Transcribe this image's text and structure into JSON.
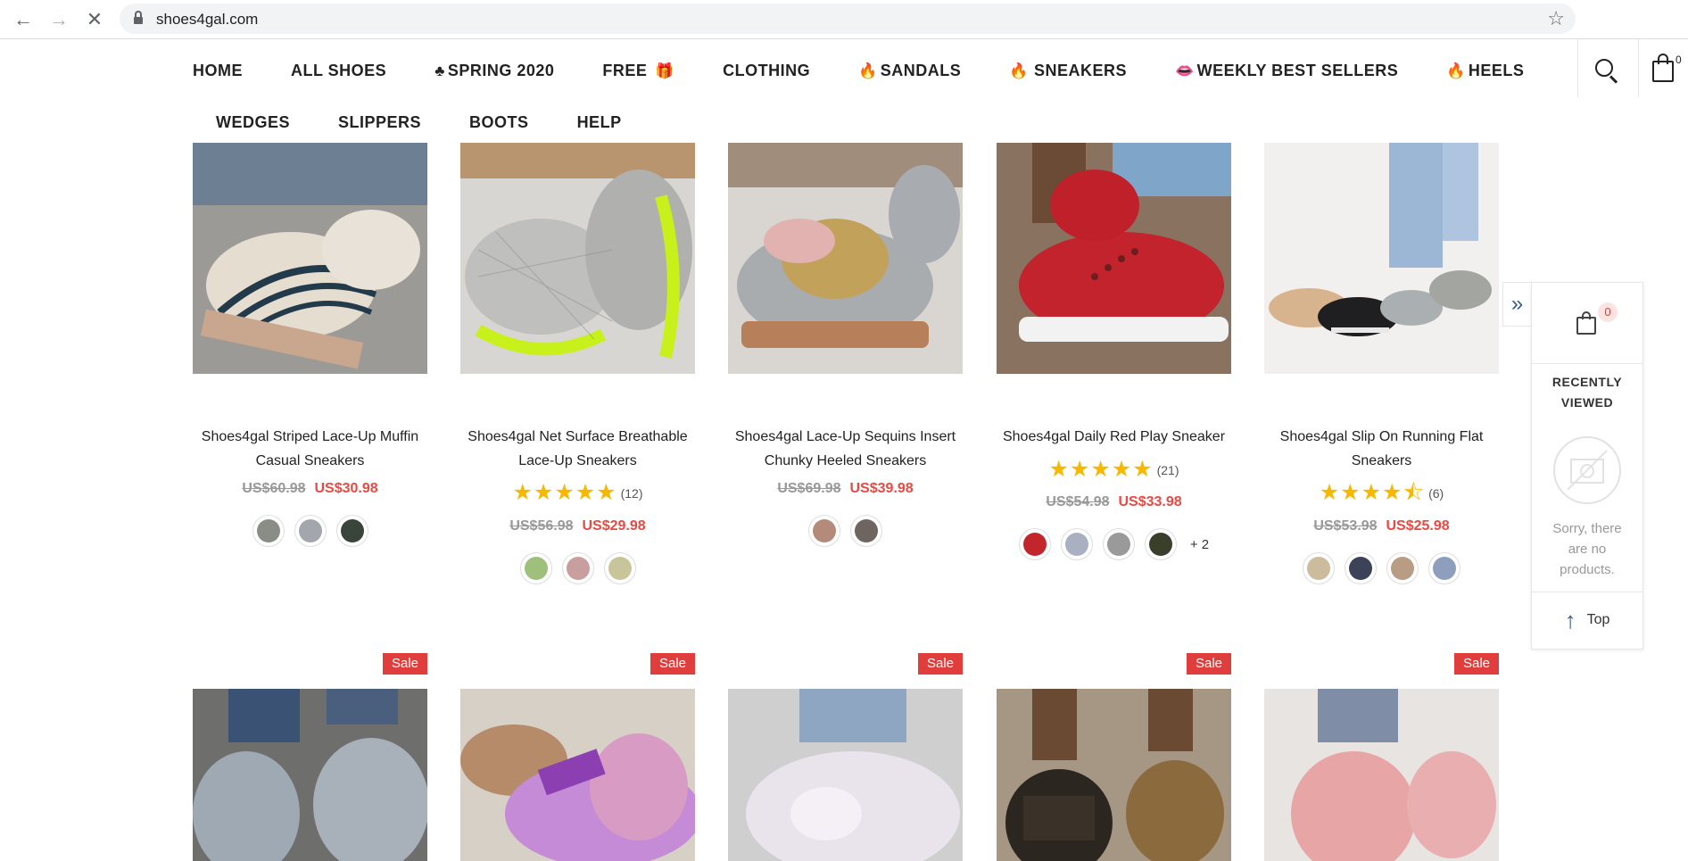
{
  "browser": {
    "url": "shoes4gal.com",
    "back_icon": "back-arrow-icon",
    "forward_icon": "forward-arrow-icon",
    "stop_icon": "close-icon",
    "star_icon": "bookmark-star-icon"
  },
  "header": {
    "menu_row1": [
      {
        "label": "HOME",
        "icon": ""
      },
      {
        "label": "ALL SHOES",
        "icon": ""
      },
      {
        "label": "SPRING 2020",
        "icon": "shamrock-icon"
      },
      {
        "label": "FREE",
        "icon": "gift-icon"
      },
      {
        "label": "CLOTHING",
        "icon": ""
      },
      {
        "label": "SANDALS",
        "icon": "fire-icon"
      },
      {
        "label": "SNEAKERS",
        "icon": "fire-icon"
      },
      {
        "label": "WEEKLY BEST SELLERS",
        "icon": "lips-icon"
      },
      {
        "label": "HEELS",
        "icon": "fire-icon"
      }
    ],
    "menu_row2": [
      {
        "label": "WEDGES"
      },
      {
        "label": "SLIPPERS"
      },
      {
        "label": "BOOTS"
      },
      {
        "label": "HELP"
      }
    ],
    "cart_count": "0"
  },
  "products_row1": [
    {
      "name_line1": "Shoes4gal Striped Lace-Up Muffin",
      "name_line2": "Casual Sneakers",
      "stars": "",
      "rating_count": "",
      "old_price": "US$60.98",
      "new_price": "US$30.98",
      "swatches": [
        "#8a8d86",
        "#a3a6ad",
        "#39443a"
      ],
      "more": ""
    },
    {
      "name_line1": "Shoes4gal Net Surface Breathable",
      "name_line2": "Lace-Up Sneakers",
      "stars": "★★★★★",
      "rating_count": "(12)",
      "old_price": "US$56.98",
      "new_price": "US$29.98",
      "swatches": [
        "#9fc07c",
        "#c99e9e",
        "#c9c59a"
      ],
      "more": ""
    },
    {
      "name_line1": "Shoes4gal Lace-Up Sequins Insert",
      "name_line2": "Chunky Heeled Sneakers",
      "stars": "",
      "rating_count": "",
      "old_price": "US$69.98",
      "new_price": "US$39.98",
      "swatches": [
        "#b48b7a",
        "#6e6560"
      ],
      "more": ""
    },
    {
      "name_line1": "Shoes4gal Daily Red Play Sneaker",
      "name_line2": "",
      "stars": "★★★★★",
      "rating_count": "(21)",
      "old_price": "US$54.98",
      "new_price": "US$33.98",
      "swatches": [
        "#c2262c",
        "#a8b0c2",
        "#9a9a9a",
        "#3a3f2c"
      ],
      "more": "+ 2"
    },
    {
      "name_line1": "Shoes4gal Slip On Running Flat",
      "name_line2": "Sneakers",
      "stars": "★★★★⯪",
      "rating_count": "(6)",
      "old_price": "US$53.98",
      "new_price": "US$25.98",
      "swatches": [
        "#cdbb9d",
        "#3c4358",
        "#b89c83",
        "#8d9fbd"
      ],
      "more": ""
    }
  ],
  "products_row2": [
    {
      "badge": "Sale"
    },
    {
      "badge": "Sale"
    },
    {
      "badge": "Sale"
    },
    {
      "badge": "Sale"
    },
    {
      "badge": "Sale"
    }
  ],
  "recently_viewed": {
    "count": "0",
    "title_line1": "RECENTLY",
    "title_line2": "VIEWED",
    "empty_line1": "Sorry, there",
    "empty_line2": "are no",
    "empty_line3": "products.",
    "top_label": "Top"
  }
}
